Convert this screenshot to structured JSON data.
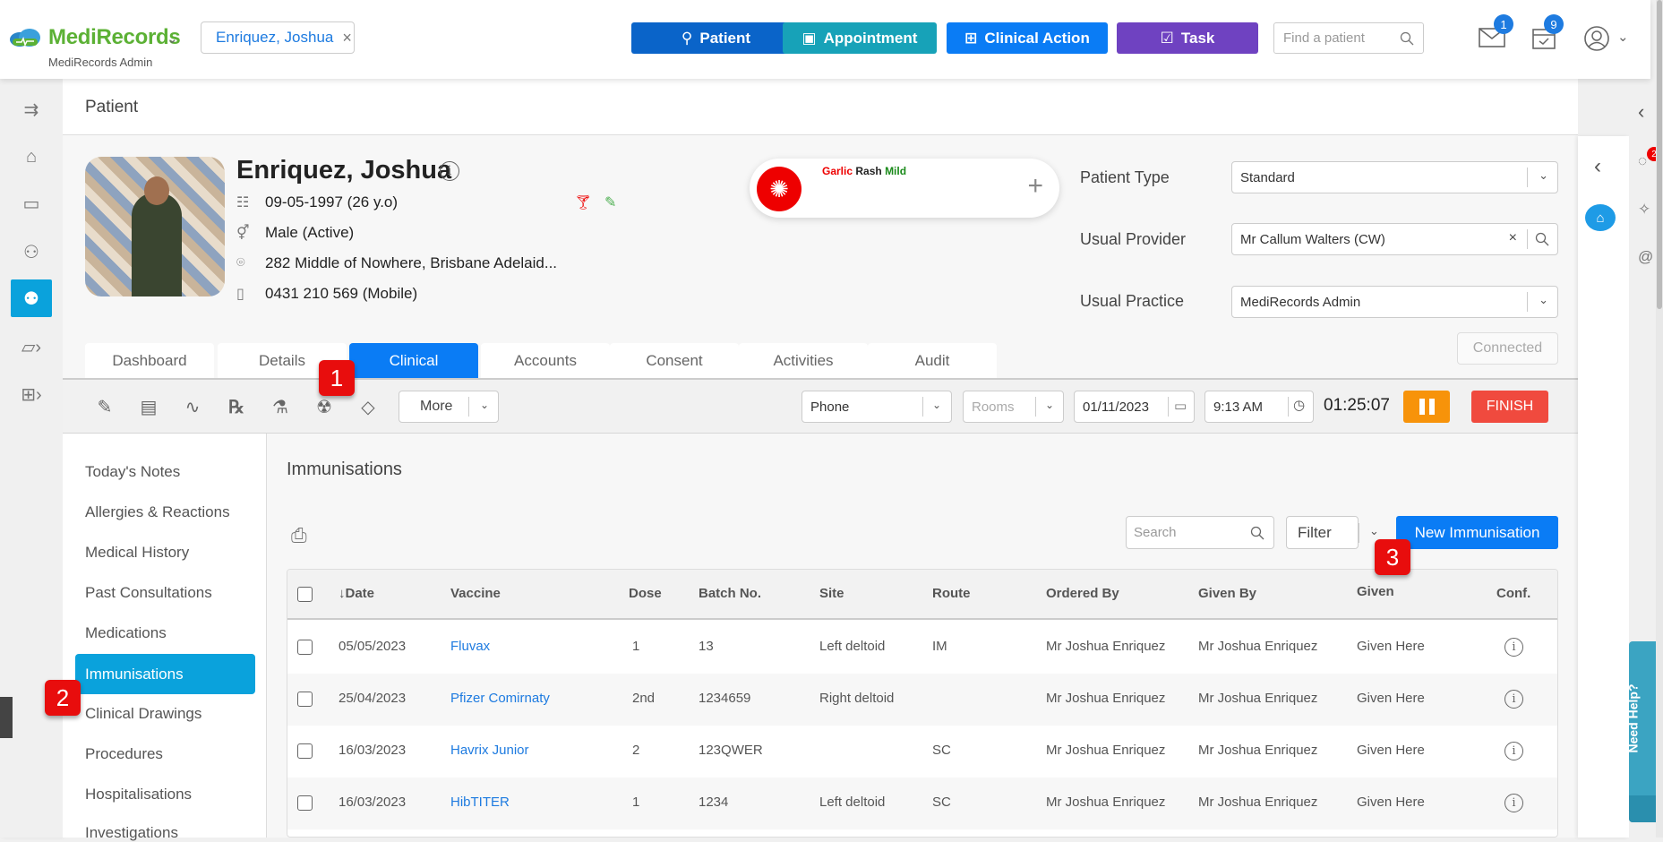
{
  "header": {
    "brand": "MediRecords",
    "brand_sub": "MediRecords Admin",
    "patient_chip": "Enriquez, Joshua",
    "buttons": [
      {
        "label": "Patient",
        "icon": "person-add-icon",
        "color": "#0a64c9"
      },
      {
        "label": "Appointment",
        "icon": "calendar-plus-icon",
        "color": "#17a2b8"
      },
      {
        "label": "Clinical Action",
        "icon": "medical-kit-icon",
        "color": "#0a7cf5"
      },
      {
        "label": "Task",
        "icon": "clipboard-check-icon",
        "color": "#6f42c1"
      }
    ],
    "find_placeholder": "Find a patient",
    "mail_badge": "1",
    "tasks_badge": "9"
  },
  "page": {
    "title": "Patient"
  },
  "patient": {
    "name": "Enriquez, Joshua",
    "dob": "09-05-1997 (26 y.o)",
    "gender": "Male (Active)",
    "address": "282 Middle of Nowhere, Brisbane Adelaid...",
    "phone": "0431 210 569 (Mobile)",
    "allergy": {
      "substance": "Garlic",
      "reaction": "Rash",
      "severity": "Mild"
    }
  },
  "fields": {
    "patient_type_label": "Patient Type",
    "patient_type": "Standard",
    "usual_provider_label": "Usual Provider",
    "usual_provider": "Mr Callum Walters (CW)",
    "usual_practice_label": "Usual Practice",
    "usual_practice": "MediRecords Admin",
    "connected": "Connected"
  },
  "tabs": [
    "Dashboard",
    "Details",
    "Clinical",
    "Accounts",
    "Consent",
    "Activities",
    "Audit"
  ],
  "active_tab": "Clinical",
  "toolbar": {
    "more": "More",
    "channel": "Phone",
    "rooms_placeholder": "Rooms",
    "date": "01/11/2023",
    "time": "9:13 AM",
    "timer": "01:25:07",
    "finish": "FINISH"
  },
  "subnav": [
    "Today's Notes",
    "Allergies & Reactions",
    "Medical History",
    "Past Consultations",
    "Medications",
    "Immunisations",
    "Clinical Drawings",
    "Procedures",
    "Hospitalisations",
    "Investigations"
  ],
  "subnav_active": "Immunisations",
  "content": {
    "title": "Immunisations",
    "search_placeholder": "Search",
    "filter": "Filter",
    "new_button": "New Immunisation",
    "columns": [
      "↓Date",
      "Vaccine",
      "Dose",
      "Batch No.",
      "Site",
      "Route",
      "Ordered By",
      "Given By",
      "Given",
      "Conf."
    ],
    "rows": [
      {
        "date": "05/05/2023",
        "vaccine": "Fluvax",
        "dose": "1",
        "batch": "13",
        "site": "Left deltoid",
        "route": "IM",
        "ordered_by": "Mr Joshua Enriquez",
        "given_by": "Mr Joshua Enriquez",
        "given": "Given Here"
      },
      {
        "date": "25/04/2023",
        "vaccine": "Pfizer Comirnaty",
        "dose": "2nd",
        "batch": "1234659",
        "site": "Right deltoid",
        "route": "",
        "ordered_by": "Mr Joshua Enriquez",
        "given_by": "Mr Joshua Enriquez",
        "given": "Given Here"
      },
      {
        "date": "16/03/2023",
        "vaccine": "Havrix Junior",
        "dose": "2",
        "batch": "123QWER",
        "site": "",
        "route": "SC",
        "ordered_by": "Mr Joshua Enriquez",
        "given_by": "Mr Joshua Enriquez",
        "given": "Given Here"
      },
      {
        "date": "16/03/2023",
        "vaccine": "HibTITER",
        "dose": "1",
        "batch": "1234",
        "site": "Left deltoid",
        "route": "SC",
        "ordered_by": "Mr Joshua Enriquez",
        "given_by": "Mr Joshua Enriquez",
        "given": "Given Here"
      }
    ]
  },
  "markers": [
    "1",
    "2",
    "3"
  ],
  "right_panel": {
    "chat_badge": "2",
    "help": "Need Help?"
  }
}
